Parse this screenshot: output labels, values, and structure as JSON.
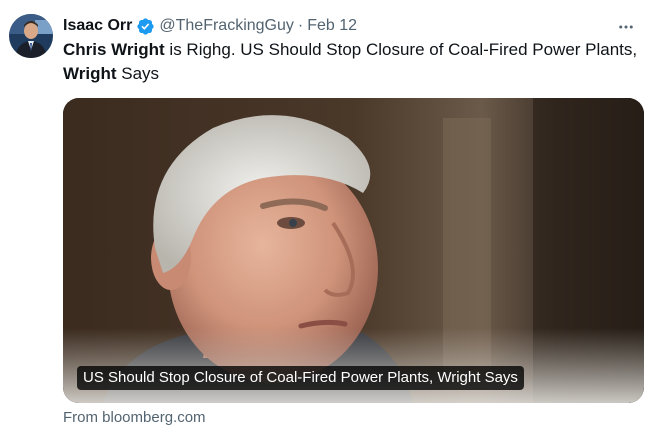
{
  "tweet": {
    "author": {
      "display_name": "Isaac Orr",
      "handle": "@TheFrackingGuy",
      "verified": true,
      "avatar_icon": "user-avatar-photo"
    },
    "separator": "·",
    "date": "Feb 12",
    "more_icon": "more-dots-icon",
    "text": {
      "bold1": "Chris Wright",
      "part1": " is Righg. US Should Stop Closure of Coal-Fired Power Plants, ",
      "bold2": "Wright",
      "part2": " Says"
    },
    "card": {
      "caption": "US Should Stop Closure of Coal-Fired Power Plants, Wright Says",
      "source": "From bloomberg.com"
    }
  },
  "colors": {
    "verified_badge": "#1d9bf0",
    "secondary_text": "#536471",
    "primary_text": "#0f1419"
  }
}
